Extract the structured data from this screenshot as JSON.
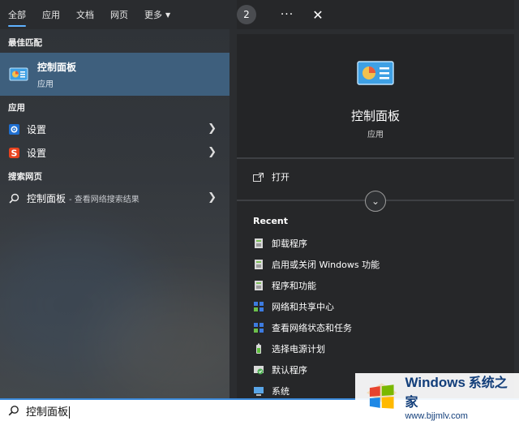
{
  "tabs": [
    {
      "label": "全部"
    },
    {
      "label": "应用"
    },
    {
      "label": "文档"
    },
    {
      "label": "网页"
    },
    {
      "label": "更多"
    }
  ],
  "badge_count": "2",
  "sections": {
    "best_match": "最佳匹配",
    "apps": "应用",
    "web": "搜索网页"
  },
  "best_match": {
    "title": "控制面板",
    "type": "应用"
  },
  "app_results": [
    {
      "label": "设置",
      "icon": "settings-gear-icon"
    },
    {
      "label": "设置",
      "icon": "sogou-s-icon"
    }
  ],
  "web_result": {
    "label": "控制面板",
    "suffix": " - 查看网络搜索结果"
  },
  "preview": {
    "title": "控制面板",
    "type": "应用",
    "open_label": "打开",
    "recent_heading": "Recent"
  },
  "recent": [
    {
      "label": "卸载程序",
      "icon": "program-icon"
    },
    {
      "label": "启用或关闭 Windows 功能",
      "icon": "program-icon"
    },
    {
      "label": "程序和功能",
      "icon": "program-icon"
    },
    {
      "label": "网络和共享中心",
      "icon": "network-icon"
    },
    {
      "label": "查看网络状态和任务",
      "icon": "network-icon"
    },
    {
      "label": "选择电源计划",
      "icon": "power-icon"
    },
    {
      "label": "默认程序",
      "icon": "default-programs-icon"
    },
    {
      "label": "系统",
      "icon": "system-icon"
    }
  ],
  "search": {
    "value": "控制面板"
  },
  "watermark": {
    "brand": "Windows",
    "brand_cn": "系统之家",
    "url": "www.bjjmlv.com"
  },
  "colors": {
    "accent": "#5fb2ff",
    "selected": "#3e5f7d",
    "search_border": "#3a88d8"
  }
}
